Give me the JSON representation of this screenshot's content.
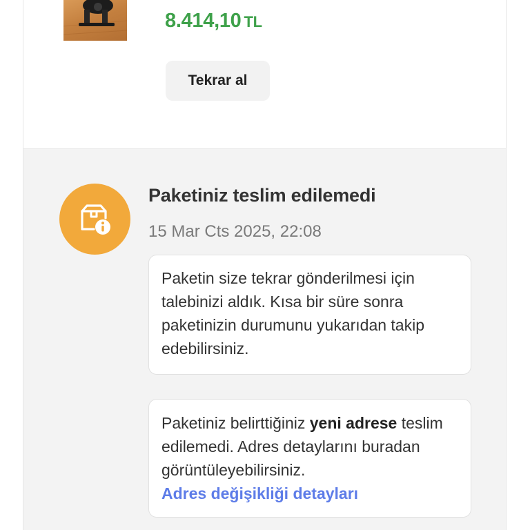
{
  "product": {
    "price": "8.414,10",
    "currency": "TL",
    "rebuy_label": "Tekrar al",
    "image_icon": "exercise-bike-photo"
  },
  "event": {
    "status_icon": "package-info-icon",
    "status_color": "#f2a93b",
    "title": "Paketiniz teslim edilemedi",
    "date": "15 Mar Cts 2025, 22:08",
    "message_1": "Paketin size tekrar gönderilmesi için talebinizi aldık. Kısa bir süre sonra paketinizin durumunu yukarıdan takip edebilirsiniz.",
    "message_2_prefix": "Paketiniz belirttiğiniz ",
    "message_2_bold": "yeni adrese",
    "message_2_suffix": " teslim edilemedi. Adres detaylarını buradan görüntüleyebilirsiniz.",
    "address_link": "Adres değişikliği detayları"
  },
  "colors": {
    "price": "#3ea14a",
    "link": "#5d7ce8",
    "section_bg": "#f3f3f3"
  }
}
